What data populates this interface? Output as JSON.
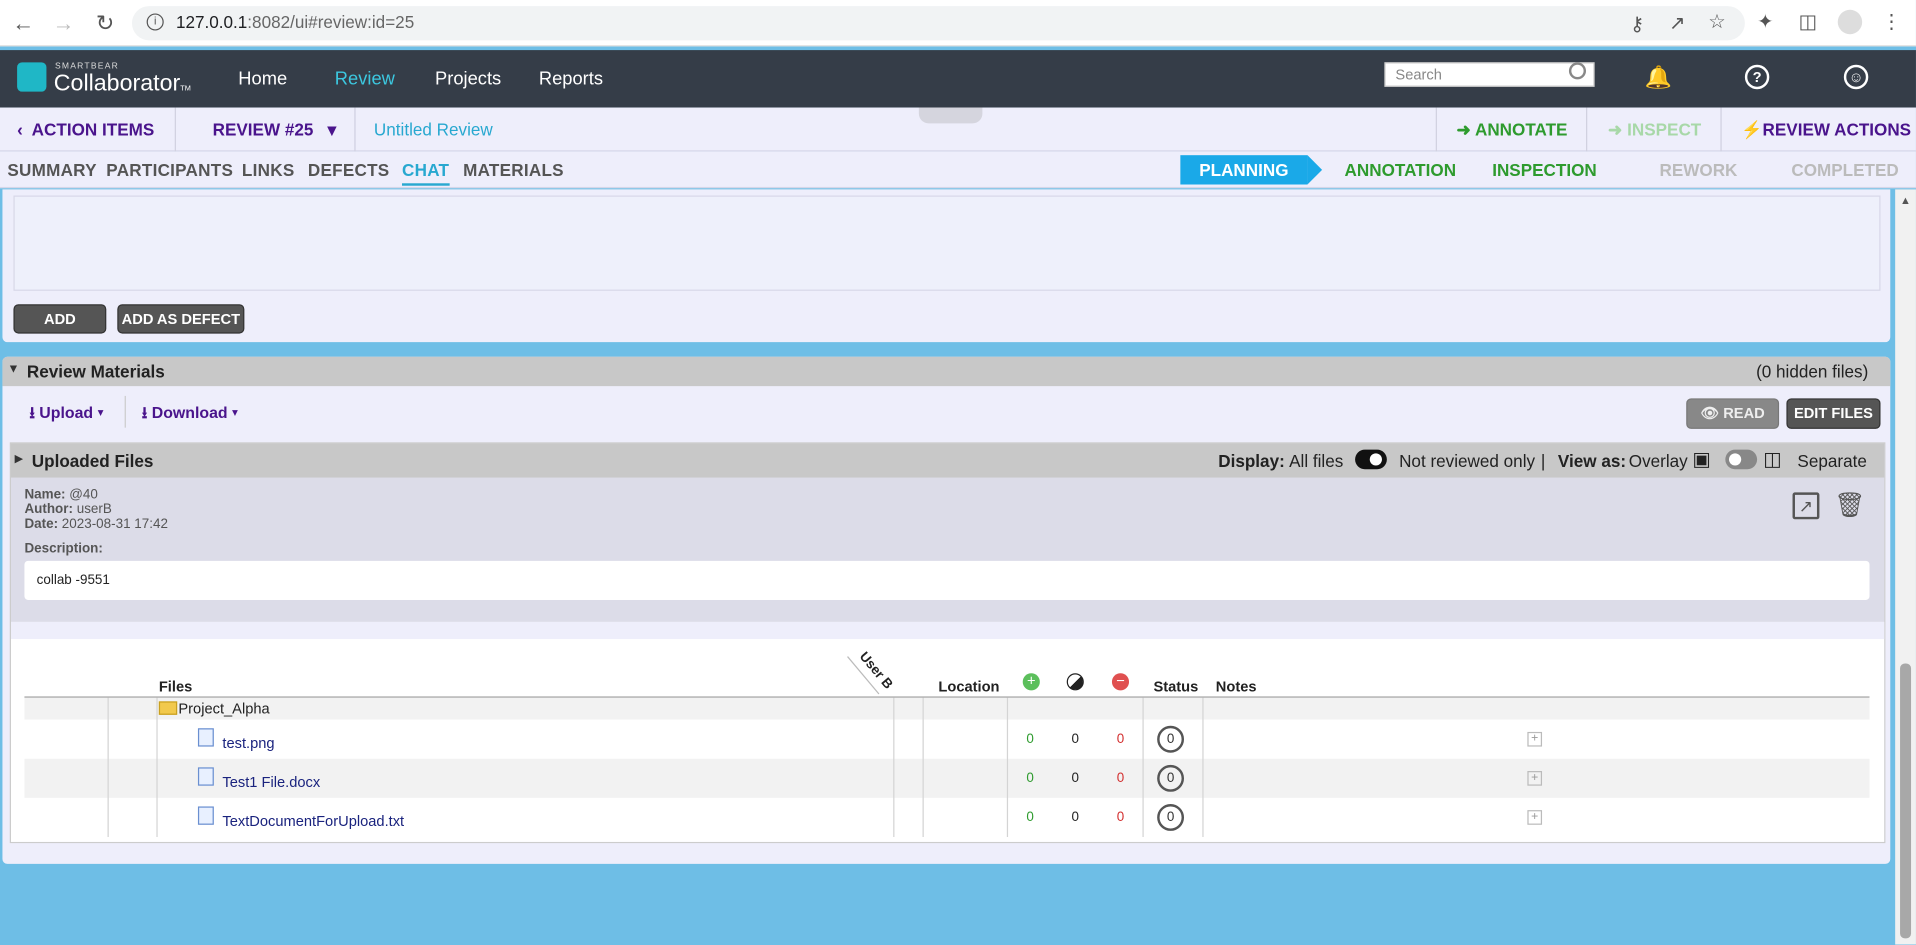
{
  "browser": {
    "url_host": "127.0.0.1",
    "url_rest": ":8082/ui#review:id=25"
  },
  "header": {
    "brand_small": "SMARTBEAR",
    "brand": "Collaborator",
    "brand_tm": "TM",
    "nav": [
      "Home",
      "Review",
      "Projects",
      "Reports"
    ],
    "active_nav": "Review",
    "search_placeholder": "Search"
  },
  "review_bar": {
    "action_items": "ACTION ITEMS",
    "review_id": "REVIEW #25",
    "title": "Untitled Review",
    "annotate": "ANNOTATE",
    "inspect": "INSPECT",
    "review_actions": "REVIEW ACTIONS"
  },
  "tabs": [
    "SUMMARY",
    "PARTICIPANTS",
    "LINKS",
    "DEFECTS",
    "CHAT",
    "MATERIALS"
  ],
  "active_tab": "CHAT",
  "phases": [
    "PLANNING",
    "ANNOTATION",
    "INSPECTION",
    "REWORK",
    "COMPLETED"
  ],
  "chat": {
    "add": "ADD",
    "add_as_defect": "ADD AS DEFECT"
  },
  "materials": {
    "title": "Review Materials",
    "hidden": "(0 hidden files)",
    "upload": "Upload",
    "download": "Download",
    "read": "READ",
    "edit_files": "EDIT FILES",
    "uploaded_title": "Uploaded Files",
    "display_label": "Display:",
    "all_files": "All files",
    "not_reviewed": "Not reviewed only",
    "divider": "|",
    "view_as_label": "View as:",
    "overlay": "Overlay",
    "separate": "Separate",
    "name_label": "Name:",
    "name": "@40",
    "author_label": "Author:",
    "author": "userB",
    "date_label": "Date:",
    "date": "2023-08-31 17:42",
    "description_label": "Description:",
    "description": "collab -9551",
    "columns": {
      "files": "Files",
      "user": "User B",
      "location": "Location",
      "status": "Status",
      "notes": "Notes"
    },
    "folder": "Project_Alpha",
    "files": [
      {
        "name": "test.png",
        "added": "0",
        "modified": "0",
        "removed": "0",
        "status": "0"
      },
      {
        "name": "Test1 File.docx",
        "added": "0",
        "modified": "0",
        "removed": "0",
        "status": "0"
      },
      {
        "name": "TextDocumentForUpload.txt",
        "added": "0",
        "modified": "0",
        "removed": "0",
        "status": "0"
      }
    ]
  }
}
